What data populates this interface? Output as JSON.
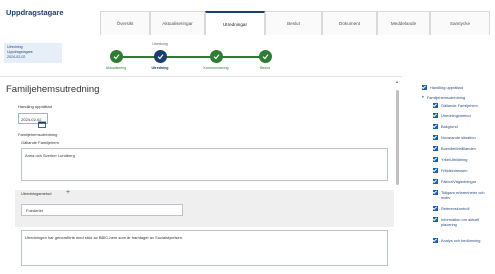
{
  "app_title": "Uppdragstagare",
  "tabs": [
    {
      "label": "Översikt"
    },
    {
      "label": "Aktualiseringar"
    },
    {
      "label": "Utredningar"
    },
    {
      "label": "Beslut"
    },
    {
      "label": "Dokument"
    },
    {
      "label": "Meddelande"
    },
    {
      "label": "Samtycke"
    }
  ],
  "case_info": {
    "line1": "Utredning",
    "line2": "Uppdragstagare",
    "line3": "2024-02-02"
  },
  "stepper": {
    "caption": "Utredning",
    "steps": [
      {
        "label": "Aktualisering"
      },
      {
        "label": "Utredning"
      },
      {
        "label": "Kommunicering"
      },
      {
        "label": "Beslut"
      }
    ]
  },
  "form": {
    "title": "Familjehemsutredning",
    "date_label": "Handling upprättad",
    "date_value": "2024-02-02",
    "family_section_label": "Familjehemsutredning",
    "family_label": "Gällande Familjehem",
    "family_value": "Anna och Sverker Lundberg",
    "method_label": "Utredningsmetod",
    "method_value": "Foederler",
    "description_value": "Utredningen har genomförts med stöd av BBIC-hem som är framtaget av Socialstyrelsen."
  },
  "sidebar": {
    "items": [
      {
        "label": "Handling upprättad",
        "type": "checkbox"
      },
      {
        "label": "Familjehemsutredning",
        "type": "group"
      },
      {
        "label": "Gällande Familjehem",
        "type": "checkbox"
      },
      {
        "label": "Utredningsmetod",
        "type": "checkbox"
      },
      {
        "label": "Bakgrund",
        "type": "checkbox"
      },
      {
        "label": "Nuvarande situation",
        "type": "checkbox"
      },
      {
        "label": "Boendeförhållanden",
        "type": "checkbox"
      },
      {
        "label": "Yrke/Utbildning",
        "type": "checkbox"
      },
      {
        "label": "Fritidsintressen",
        "type": "checkbox"
      },
      {
        "label": "Fäktor/Vägledningar",
        "type": "checkbox"
      },
      {
        "label": "Tidigare erfarenheter och motiv",
        "type": "checkbox"
      },
      {
        "label": "Referenskontroll",
        "type": "checkbox"
      },
      {
        "label": "Information om aktuell placering",
        "type": "checkbox"
      },
      {
        "label": "Analys och bedömning",
        "type": "checkbox"
      }
    ]
  },
  "colors": {
    "brand": "#1d3d6b",
    "step_done": "#2e7d32",
    "checkbox": "#1d5fa8"
  }
}
